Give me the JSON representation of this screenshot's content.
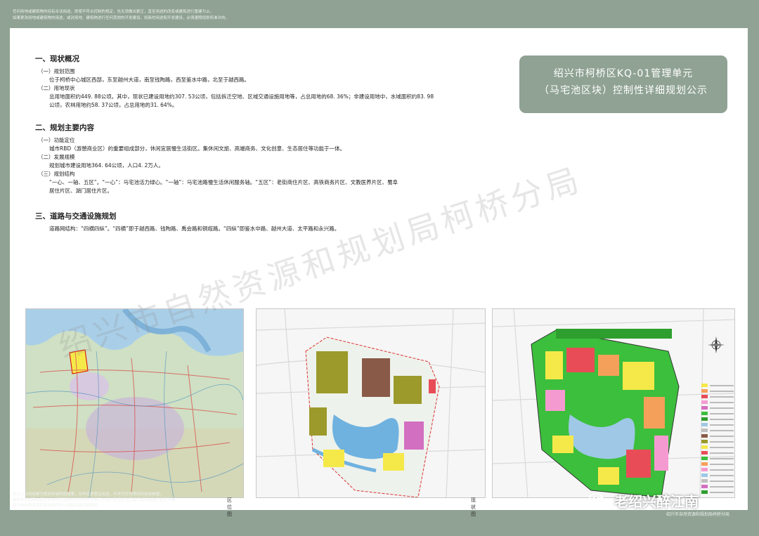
{
  "header_notice": [
    "任何用地或建筑物的经有合法用途，即使不符合控制的规定，也无须做出更正，直至用途的改变或建筑进行重建为止。",
    "如果更改用地或建筑物的用途，或对用地、建筑物进行任何其他的开发建设，则新的用途和开发建设，必须遵照规划所准许的。"
  ],
  "title": {
    "line1": "绍兴市柯桥区KQ-01管理单元",
    "line2": "（马宅池区块）控制性详细规划公示"
  },
  "sections": {
    "s1": {
      "heading": "一、现状概况",
      "sub1": "（一）规划范围",
      "sub1_text": "位于柯桥中心城区西部，东至越州大道，南至钱陶路，西至鉴水中路，北至于越西路。",
      "sub2": "（二）用地现状",
      "sub2_text1": "总用地面积约449. 88公顷。其中，现状已建设用地约307. 53公顷，包括拆迁空地、区域交通设施用地等，占总用地的68. 36%；非建设用地中，水域面积约83. 98",
      "sub2_text2": "公顷，农林用地约58. 37公顷，占总用地的31. 64%。"
    },
    "s2": {
      "heading": "二、规划主要内容",
      "sub1": "（一）功能定位",
      "sub1_text": "城市RBD（游憩商业区）的重要组成部分，休闲宜居慢生活街区。集休闲文旅、高端商务、文化创意、生态居住等功能于一体。",
      "sub2": "（二）发展规模",
      "sub2_text": "规划城市建设用地364. 64公顷，人口4. 2万人。",
      "sub3": "（三）规划结构",
      "sub3_text1": "“一心、一轴、五区”。“一心”：马宅池活力绿心。“一轴”：马宅池路慢生活休闲服务轴。“五区”：老街商住片区、高铁商务片区、文教医养片区、蜀阜",
      "sub3_text2": "居住片区、湖门居住片区。"
    },
    "s3": {
      "heading": "三、道路与交通设施规划",
      "text": "道路网结构：“四横四纵”。“四横”即于越西路、钱陶路、禹会路和铜缆路。“四纵”即鉴水中路、越州大道、太平路和永兴路。"
    }
  },
  "maps": {
    "location_caption": "区位图",
    "status_caption": "现状图"
  },
  "footer_notice": [
    "本次公示的成果为规划评审阶段成果，仅作征求意见用途，不作为任何项目的审批依据。",
    "最终规划成果由绍兴市自然资源和规划局柯桥分局汇总各方意见修改完善后报同级政府批复为准。",
    "绍兴市自然资源和规划局柯桥分局拥有最终解释权。"
  ],
  "org_label": "绍兴市自然资源和规划局柯桥分局",
  "brand_text": "老绍兴醉江南",
  "watermark_text": "绍兴市自然资源和规划局柯桥分局",
  "colors": {
    "background": "#8fa293",
    "residential": "#f5e94a",
    "commercial": "#e84d57",
    "green": "#3cbf3c",
    "water": "#9ec8e6",
    "existing_built": "#8a7a3a"
  }
}
